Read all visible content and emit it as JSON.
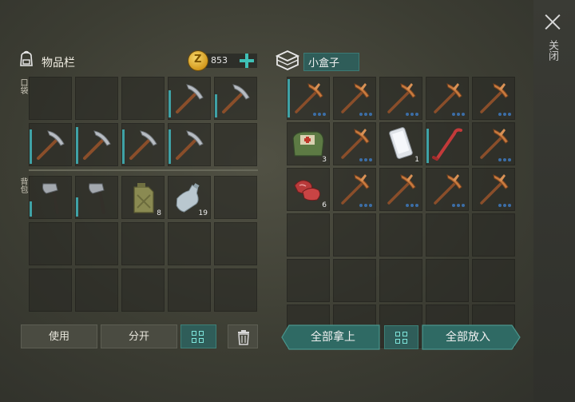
{
  "side": {
    "close_label": "关闭",
    "close_icon": "close-x-icon"
  },
  "inventory": {
    "title": "物品栏",
    "coins": "853",
    "pocket_label": "口袋",
    "backpack_label": "背包",
    "pocket_slots": [
      {
        "item": "empty"
      },
      {
        "item": "empty"
      },
      {
        "item": "empty"
      },
      {
        "item": "pickaxe",
        "durability": 0.7
      },
      {
        "item": "pickaxe",
        "durability": 0.6
      },
      {
        "item": "pickaxe",
        "durability": 0.9
      },
      {
        "item": "pickaxe",
        "durability": 0.95
      },
      {
        "item": "pickaxe",
        "durability": 0.9
      },
      {
        "item": "pickaxe",
        "durability": 0.9
      },
      {
        "item": "empty"
      }
    ],
    "backpack_slots": [
      {
        "item": "hatchet",
        "durability": 0.4
      },
      {
        "item": "hatchet",
        "durability": 0.5
      },
      {
        "item": "jerrycan",
        "count": "8"
      },
      {
        "item": "water-bottle",
        "count": "19"
      },
      {
        "item": "empty"
      },
      {
        "item": "empty"
      },
      {
        "item": "empty"
      },
      {
        "item": "empty"
      },
      {
        "item": "empty"
      },
      {
        "item": "empty"
      },
      {
        "item": "empty"
      },
      {
        "item": "empty"
      },
      {
        "item": "empty"
      },
      {
        "item": "empty"
      },
      {
        "item": "empty"
      }
    ],
    "buttons": {
      "use": "使用",
      "split": "分开"
    }
  },
  "box": {
    "title": "小盒子",
    "slots": [
      {
        "item": "copper-pickaxe",
        "durability": 1.0,
        "dots": true
      },
      {
        "item": "copper-pickaxe",
        "dots": true
      },
      {
        "item": "copper-pickaxe",
        "dots": true
      },
      {
        "item": "copper-pickaxe",
        "dots": true
      },
      {
        "item": "copper-pickaxe",
        "dots": true
      },
      {
        "item": "first-aid-bag",
        "count": "3"
      },
      {
        "item": "copper-pickaxe",
        "dots": true
      },
      {
        "item": "smartphone",
        "count": "1"
      },
      {
        "item": "crowbar",
        "durability": 0.9
      },
      {
        "item": "copper-pickaxe",
        "dots": true
      },
      {
        "item": "raw-meat",
        "count": "6"
      },
      {
        "item": "copper-pickaxe",
        "dots": true
      },
      {
        "item": "copper-pickaxe",
        "dots": true
      },
      {
        "item": "copper-pickaxe",
        "dots": true
      },
      {
        "item": "copper-pickaxe",
        "dots": true
      },
      {
        "item": "empty"
      },
      {
        "item": "empty"
      },
      {
        "item": "empty"
      },
      {
        "item": "empty"
      },
      {
        "item": "empty"
      },
      {
        "item": "empty"
      },
      {
        "item": "empty"
      },
      {
        "item": "empty"
      },
      {
        "item": "empty"
      },
      {
        "item": "empty"
      },
      {
        "item": "empty"
      },
      {
        "item": "empty"
      },
      {
        "item": "empty"
      },
      {
        "item": "empty"
      },
      {
        "item": "empty"
      }
    ],
    "buttons": {
      "take_all": "全部拿上",
      "put_all": "全部放入"
    }
  },
  "colors": {
    "accent": "#3fc0b6",
    "durability": "#3fa2a6",
    "panel_bg": "#3c3d33"
  }
}
